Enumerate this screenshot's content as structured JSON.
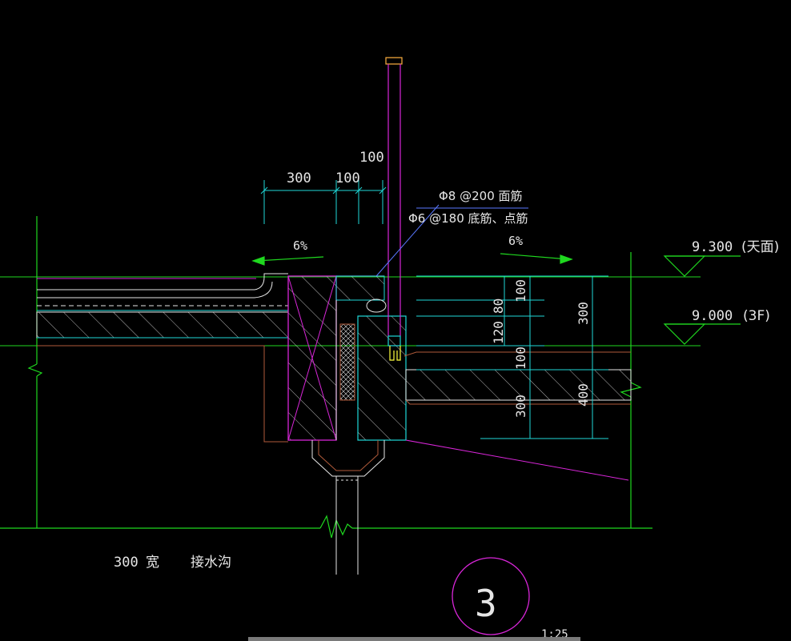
{
  "dimensions": {
    "top_300": "300",
    "top_100_a": "100",
    "top_100_b": "100",
    "right_100_a": "100",
    "right_80": "80",
    "right_120": "120",
    "right_100_b": "100",
    "right_300_a": "300",
    "right_300_b": "300",
    "right_400": "400"
  },
  "rebar_notes": {
    "top_bar": "Φ8 @200 面筋",
    "bottom_bar": "Φ6 @180 底筋、点筋"
  },
  "slopes": {
    "left": "6%",
    "right": "6%"
  },
  "levels": {
    "roof": {
      "value": "9.300",
      "note": "(天面)"
    },
    "floor": {
      "value": "9.000",
      "note": "(3F)"
    }
  },
  "caption": {
    "width": "300",
    "word_width": "宽",
    "name": "接水沟"
  },
  "detail_marker": {
    "number": "3",
    "scale": "1:25"
  },
  "colors": {
    "background": "#000000",
    "green": "#1fd81f",
    "cyan": "#1fd8d8",
    "magenta": "#d826d8",
    "white": "#e6e6e6",
    "brown": "#b05a3a",
    "orange": "#ffb040",
    "blue": "#5a78ff"
  }
}
